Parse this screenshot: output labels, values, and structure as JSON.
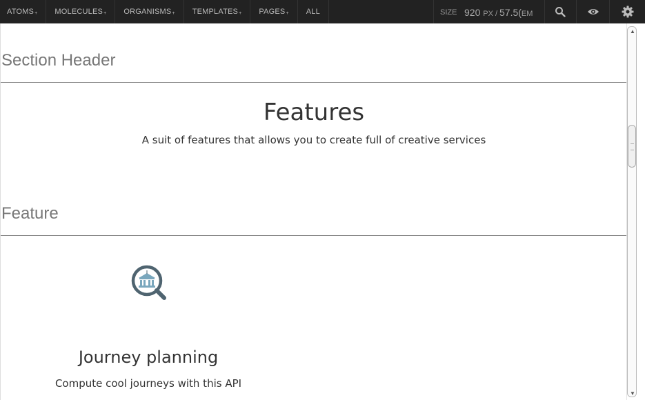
{
  "nav": {
    "items": [
      {
        "label": "ATOMS",
        "has_plus": true
      },
      {
        "label": "MOLECULES",
        "has_plus": true
      },
      {
        "label": "ORGANISMS",
        "has_plus": true
      },
      {
        "label": "TEMPLATES",
        "has_plus": true
      },
      {
        "label": "PAGES",
        "has_plus": true
      },
      {
        "label": "ALL",
        "has_plus": false
      }
    ],
    "plus_glyph": "+"
  },
  "size": {
    "label": "SIZE",
    "px_value": "920",
    "px_unit": "PX /",
    "em_value": "57.5(",
    "em_unit": "EM"
  },
  "tools": {
    "search_icon": "search-icon",
    "eye_icon": "eye-icon",
    "gear_icon": "gear-icon"
  },
  "content": {
    "section_header_title": "Section Header",
    "features_title": "Features",
    "features_subtitle": "A suit of features that allows you to create full of creative services",
    "feature_section_title": "Feature",
    "feature": {
      "icon": "magnifier-building-icon",
      "title": "Journey planning",
      "description": "Compute cool journeys with this API"
    }
  },
  "colors": {
    "topbar_bg": "#222222",
    "accent_icon": "#4f6470",
    "building": "#7aa7bd"
  }
}
